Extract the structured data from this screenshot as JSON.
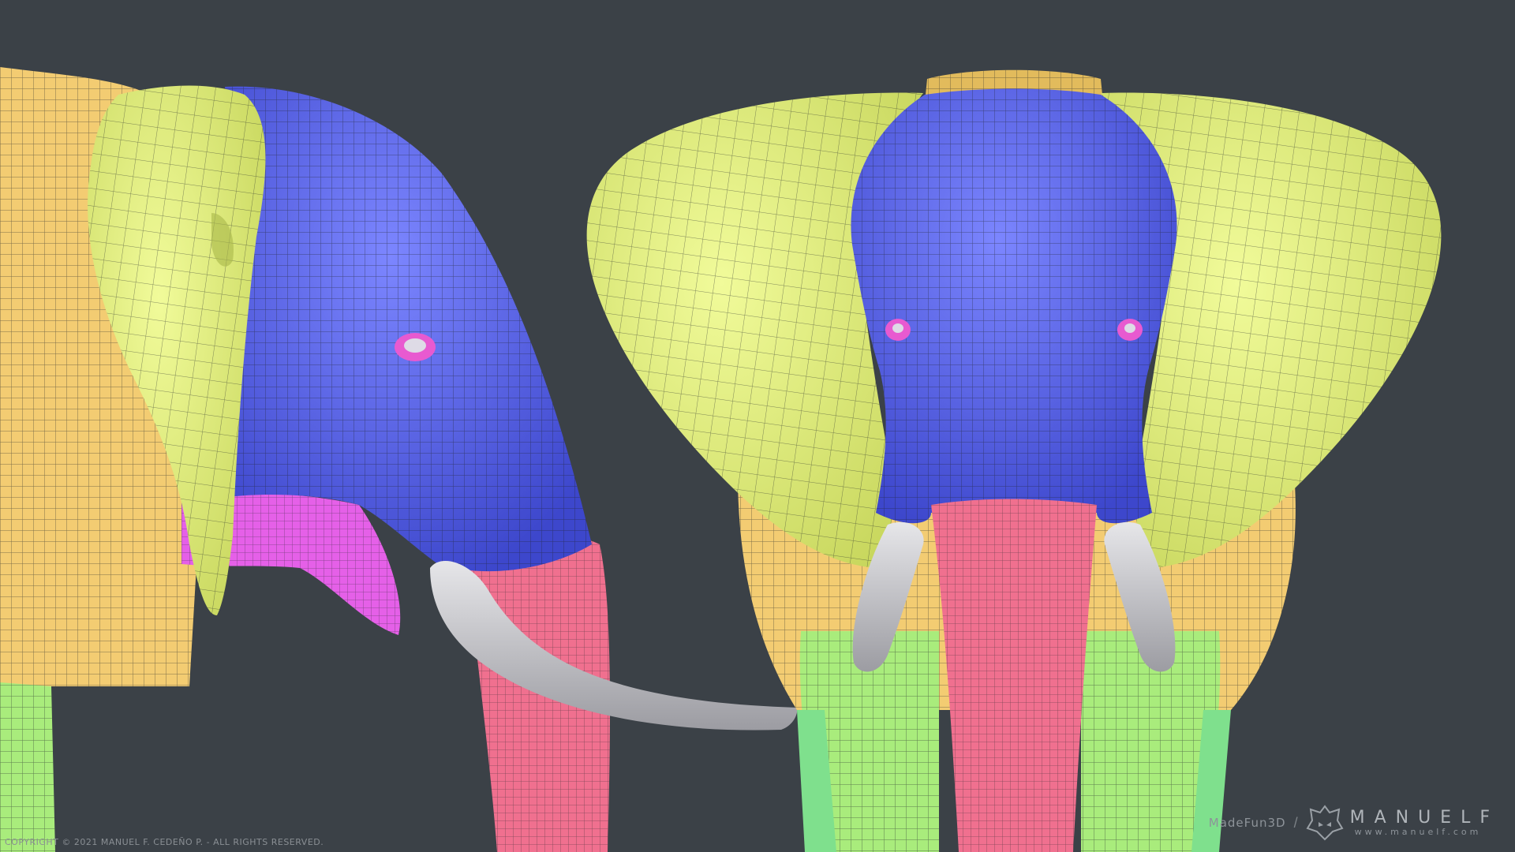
{
  "watermark": {
    "copyright": "COPYRIGHT © 2021 MANUEL F. CEDEÑO P. - ALL RIGHTS RESERVED.",
    "studio": "MadeFun3D",
    "separator": "/",
    "brand_name": "MANUELF",
    "website": "www.manuelf.com"
  },
  "colors": {
    "background": "#3b4147",
    "head": "#5b66f0",
    "ear": "#e2f27a",
    "body": "#f3cc72",
    "trunk": "#f0708f",
    "mouth": "#e560e8",
    "tusk": "#c9c9cc",
    "legs": "#a9ec7c",
    "lower_leg": "#7fe08d",
    "eye": "#e85ad0",
    "wire": "#1e2228"
  },
  "views": {
    "side": "side-view-elephant",
    "front": "front-view-elephant"
  }
}
